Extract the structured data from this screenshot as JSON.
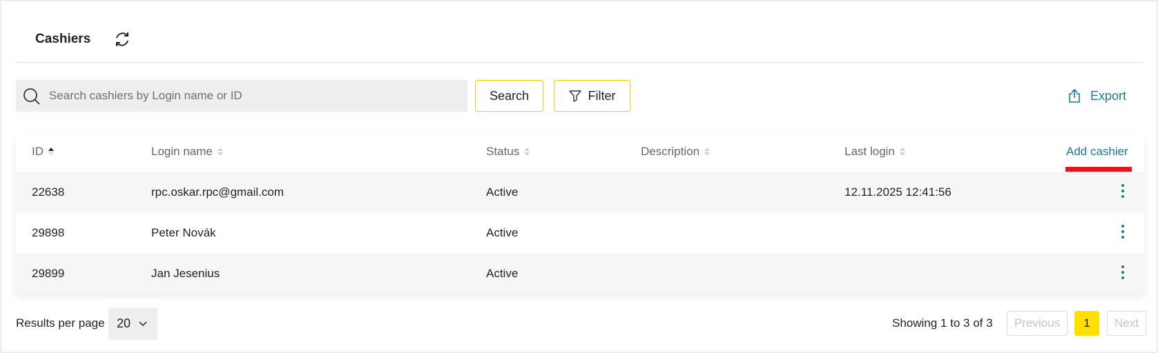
{
  "header": {
    "title": "Cashiers"
  },
  "toolbar": {
    "search_placeholder": "Search cashiers by Login name or ID",
    "search_value": "",
    "search_button": "Search",
    "filter_button": "Filter",
    "export_label": "Export"
  },
  "table": {
    "columns": [
      "ID",
      "Login name",
      "Status",
      "Description",
      "Last login"
    ],
    "sorted_column": "ID",
    "add_label": "Add cashier",
    "rows": [
      {
        "id": "22638",
        "login": "rpc.oskar.rpc@gmail.com",
        "status": "Active",
        "description": "",
        "last_login": "12.11.2025 12:41:56"
      },
      {
        "id": "29898",
        "login": "Peter Novák",
        "status": "Active",
        "description": "",
        "last_login": ""
      },
      {
        "id": "29899",
        "login": "Jan Jesenius",
        "status": "Active",
        "description": "",
        "last_login": ""
      }
    ]
  },
  "footer": {
    "results_per_page_label": "Results per page",
    "results_per_page_value": "20",
    "showing": "Showing 1 to 3 of 3",
    "previous": "Previous",
    "current_page": "1",
    "next": "Next"
  },
  "colors": {
    "accent": "#1a7a8a",
    "highlight": "#ffe000",
    "button_border": "#f0d000",
    "annotation": "#e8141b"
  },
  "icons": {
    "refresh": "refresh-icon",
    "search": "search-icon",
    "filter": "filter-icon",
    "export": "export-icon",
    "row_menu": "kebab-menu-icon"
  }
}
